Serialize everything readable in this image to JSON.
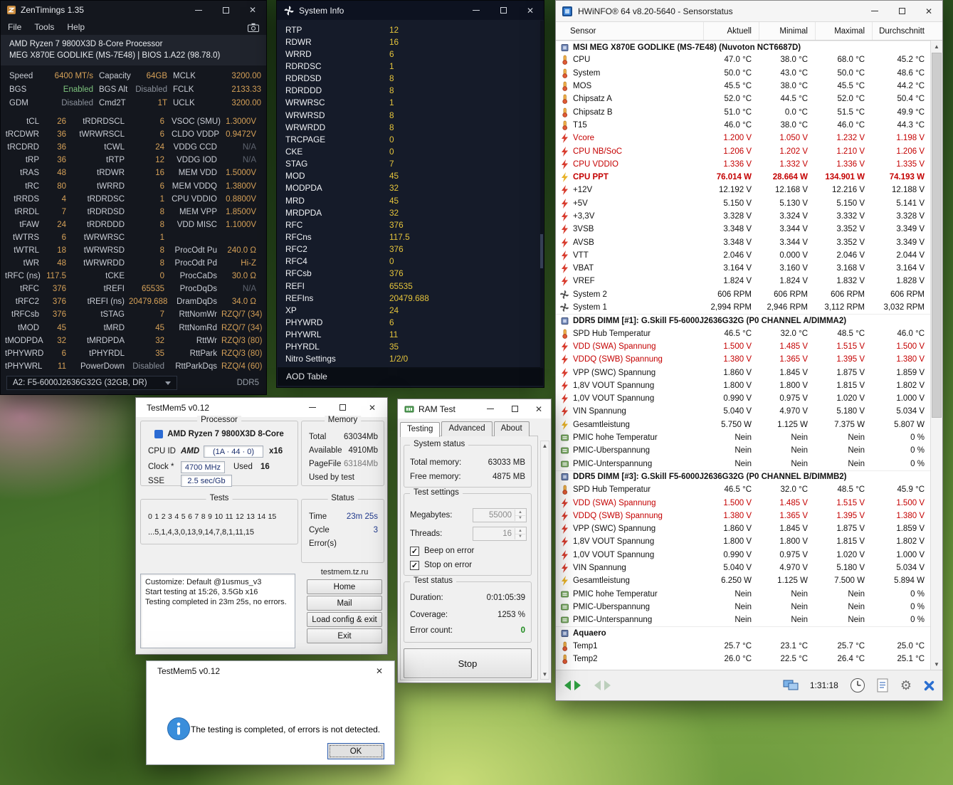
{
  "zentimings": {
    "title": "ZenTimings 1.35",
    "menu": [
      "File",
      "Tools",
      "Help"
    ],
    "cpu": "AMD Ryzen 7 9800X3D 8-Core Processor",
    "board": "MEG X870E GODLIKE (MS-7E48) | BIOS 1.A22 (98.78.0)",
    "config": [
      [
        "Speed",
        "6400 MT/s"
      ],
      [
        "Capacity",
        "64GB"
      ],
      [
        "MCLK",
        "3200.00"
      ],
      [
        "BGS",
        "Enabled"
      ],
      [
        "BGS Alt",
        "Disabled"
      ],
      [
        "FCLK",
        "2133.33"
      ],
      [
        "GDM",
        "Disabled"
      ],
      [
        "Cmd2T",
        "1T"
      ],
      [
        "UCLK",
        "3200.00"
      ]
    ],
    "timings": [
      [
        "tCL",
        "26",
        "tRDRDSCL",
        "6",
        "VSOC (SMU)",
        "1.3000V"
      ],
      [
        "tRCDWR",
        "36",
        "tWRWRSCL",
        "6",
        "CLDO VDDP",
        "0.9472V"
      ],
      [
        "tRCDRD",
        "36",
        "tCWL",
        "24",
        "VDDG CCD",
        "N/A"
      ],
      [
        "tRP",
        "36",
        "tRTP",
        "12",
        "VDDG IOD",
        "N/A"
      ],
      [
        "tRAS",
        "48",
        "tRDWR",
        "16",
        "MEM VDD",
        "1.5000V"
      ],
      [
        "tRC",
        "80",
        "tWRRD",
        "6",
        "MEM VDDQ",
        "1.3800V"
      ],
      [
        "tRRDS",
        "4",
        "tRDRDSC",
        "1",
        "CPU VDDIO",
        "0.8800V"
      ],
      [
        "tRRDL",
        "7",
        "tRDRDSD",
        "8",
        "MEM VPP",
        "1.8500V"
      ],
      [
        "tFAW",
        "24",
        "tRDRDDD",
        "8",
        "VDD MISC",
        "1.1000V"
      ],
      [
        "tWTRS",
        "6",
        "tWRWRSC",
        "1",
        "",
        ""
      ],
      [
        "tWTRL",
        "18",
        "tWRWRSD",
        "8",
        "ProcOdt Pu",
        "240.0 Ω"
      ],
      [
        "tWR",
        "48",
        "tWRWRDD",
        "8",
        "ProcOdt Pd",
        "Hi-Z"
      ],
      [
        "tRFC (ns)",
        "117.5",
        "tCKE",
        "0",
        "ProcCaDs",
        "30.0 Ω"
      ],
      [
        "tRFC",
        "376",
        "tREFI",
        "65535",
        "ProcDqDs",
        "N/A"
      ],
      [
        "tRFC2",
        "376",
        "tREFI (ns)",
        "20479.688",
        "DramDqDs",
        "34.0 Ω"
      ],
      [
        "tRFCsb",
        "376",
        "tSTAG",
        "7",
        "RttNomWr",
        "RZQ/7 (34)"
      ],
      [
        "tMOD",
        "45",
        "tMRD",
        "45",
        "RttNomRd",
        "RZQ/7 (34)"
      ],
      [
        "tMODPDA",
        "32",
        "tMRDPDA",
        "32",
        "RttWr",
        "RZQ/3 (80)"
      ],
      [
        "tPHYWRD",
        "6",
        "tPHYRDL",
        "35",
        "RttPark",
        "RZQ/3 (80)"
      ],
      [
        "tPHYWRL",
        "11",
        "PowerDown",
        "Disabled",
        "RttParkDqs",
        "RZQ/4 (60)"
      ]
    ],
    "dimm": "A2: F5-6000J2636G32G (32GB, DR)",
    "memtype": "DDR5"
  },
  "systeminfo": {
    "title": "System Info",
    "rows": [
      [
        "RTP",
        "12"
      ],
      [
        "RDWR",
        "16"
      ],
      [
        "WRRD",
        "6"
      ],
      [
        "RDRDSC",
        "1"
      ],
      [
        "RDRDSD",
        "8"
      ],
      [
        "RDRDDD",
        "8"
      ],
      [
        "WRWRSC",
        "1"
      ],
      [
        "WRWRSD",
        "8"
      ],
      [
        "WRWRDD",
        "8"
      ],
      [
        "TRCPAGE",
        "0"
      ],
      [
        "CKE",
        "0"
      ],
      [
        "STAG",
        "7"
      ],
      [
        "MOD",
        "45"
      ],
      [
        "MODPDA",
        "32"
      ],
      [
        "MRD",
        "45"
      ],
      [
        "MRDPDA",
        "32"
      ],
      [
        "RFC",
        "376"
      ],
      [
        "RFCns",
        "117.5"
      ],
      [
        "RFC2",
        "376"
      ],
      [
        "RFC4",
        "0"
      ],
      [
        "RFCsb",
        "376"
      ],
      [
        "REFI",
        "65535"
      ],
      [
        "REFIns",
        "20479.688"
      ],
      [
        "XP",
        "24"
      ],
      [
        "PHYWRD",
        "6"
      ],
      [
        "PHYWRL",
        "11"
      ],
      [
        "PHYRDL",
        "35"
      ],
      [
        "Nitro Settings",
        "1/2/0"
      ]
    ],
    "aod": "AOD Table"
  },
  "hwinfo": {
    "title": "HWiNFO® 64 v8.20-5640 - Sensorstatus",
    "columns": [
      "Sensor",
      "Aktuell",
      "Minimal",
      "Maximal",
      "Durchschnitt"
    ],
    "statusbar_time": "1:31:18",
    "groups": [
      {
        "name": "MSI MEG X870E GODLIKE (MS-7E48) (Nuvoton NCT6687D)",
        "rows": [
          {
            "i": "temp",
            "l": "CPU",
            "v": [
              "47.0 °C",
              "38.0 °C",
              "68.0 °C",
              "45.2 °C"
            ]
          },
          {
            "i": "temp",
            "l": "System",
            "v": [
              "50.0 °C",
              "43.0 °C",
              "50.0 °C",
              "48.6 °C"
            ]
          },
          {
            "i": "temp",
            "l": "MOS",
            "v": [
              "45.5 °C",
              "38.0 °C",
              "45.5 °C",
              "44.2 °C"
            ]
          },
          {
            "i": "temp",
            "l": "Chipsatz A",
            "v": [
              "52.0 °C",
              "44.5 °C",
              "52.0 °C",
              "50.4 °C"
            ]
          },
          {
            "i": "temp",
            "l": "Chipsatz B",
            "v": [
              "51.0 °C",
              "0.0 °C",
              "51.5 °C",
              "49.9 °C"
            ]
          },
          {
            "i": "temp",
            "l": "T15",
            "v": [
              "46.0 °C",
              "38.0 °C",
              "46.0 °C",
              "44.3 °C"
            ]
          },
          {
            "i": "volt",
            "l": "Vcore",
            "f": 1,
            "v": [
              "1.200 V",
              "1.050 V",
              "1.232 V",
              "1.198 V"
            ]
          },
          {
            "i": "volt",
            "l": "CPU NB/SoC",
            "f": 1,
            "v": [
              "1.206 V",
              "1.202 V",
              "1.210 V",
              "1.206 V"
            ]
          },
          {
            "i": "volt",
            "l": "CPU VDDIO",
            "f": 1,
            "v": [
              "1.336 V",
              "1.332 V",
              "1.336 V",
              "1.335 V"
            ]
          },
          {
            "i": "power",
            "l": "CPU PPT",
            "f": 1,
            "b": 1,
            "v": [
              "76.014 W",
              "28.664 W",
              "134.901 W",
              "74.193 W"
            ]
          },
          {
            "i": "volt",
            "l": "+12V",
            "v": [
              "12.192 V",
              "12.168 V",
              "12.216 V",
              "12.188 V"
            ]
          },
          {
            "i": "volt",
            "l": "+5V",
            "v": [
              "5.150 V",
              "5.130 V",
              "5.150 V",
              "5.141 V"
            ]
          },
          {
            "i": "volt",
            "l": "+3,3V",
            "v": [
              "3.328 V",
              "3.324 V",
              "3.332 V",
              "3.328 V"
            ]
          },
          {
            "i": "volt",
            "l": "3VSB",
            "v": [
              "3.348 V",
              "3.344 V",
              "3.352 V",
              "3.349 V"
            ]
          },
          {
            "i": "volt",
            "l": "AVSB",
            "v": [
              "3.348 V",
              "3.344 V",
              "3.352 V",
              "3.349 V"
            ]
          },
          {
            "i": "volt",
            "l": "VTT",
            "v": [
              "2.046 V",
              "0.000 V",
              "2.046 V",
              "2.044 V"
            ]
          },
          {
            "i": "volt",
            "l": "VBAT",
            "v": [
              "3.164 V",
              "3.160 V",
              "3.168 V",
              "3.164 V"
            ]
          },
          {
            "i": "volt",
            "l": "VREF",
            "v": [
              "1.824 V",
              "1.824 V",
              "1.832 V",
              "1.828 V"
            ]
          },
          {
            "i": "fan",
            "l": "System 2",
            "v": [
              "606 RPM",
              "606 RPM",
              "606 RPM",
              "606 RPM"
            ]
          },
          {
            "i": "fan",
            "l": "System 1",
            "v": [
              "2,994 RPM",
              "2,946 RPM",
              "3,112 RPM",
              "3,032 RPM"
            ]
          }
        ]
      },
      {
        "name": "DDR5 DIMM [#1]: G.Skill F5-6000J2636G32G (P0 CHANNEL A/DIMMA2)",
        "rows": [
          {
            "i": "temp",
            "l": "SPD Hub Temperatur",
            "v": [
              "46.5 °C",
              "32.0 °C",
              "48.5 °C",
              "46.0 °C"
            ]
          },
          {
            "i": "volt",
            "l": "VDD (SWA) Spannung",
            "f": 1,
            "v": [
              "1.500 V",
              "1.485 V",
              "1.515 V",
              "1.500 V"
            ]
          },
          {
            "i": "volt",
            "l": "VDDQ (SWB) Spannung",
            "f": 1,
            "v": [
              "1.380 V",
              "1.365 V",
              "1.395 V",
              "1.380 V"
            ]
          },
          {
            "i": "volt",
            "l": "VPP (SWC) Spannung",
            "v": [
              "1.860 V",
              "1.845 V",
              "1.875 V",
              "1.859 V"
            ]
          },
          {
            "i": "volt",
            "l": "1,8V VOUT Spannung",
            "v": [
              "1.800 V",
              "1.800 V",
              "1.815 V",
              "1.802 V"
            ]
          },
          {
            "i": "volt",
            "l": "1,0V VOUT Spannung",
            "v": [
              "0.990 V",
              "0.975 V",
              "1.020 V",
              "1.000 V"
            ]
          },
          {
            "i": "volt",
            "l": "VIN Spannung",
            "v": [
              "5.040 V",
              "4.970 V",
              "5.180 V",
              "5.034 V"
            ]
          },
          {
            "i": "power",
            "l": "Gesamtleistung",
            "v": [
              "5.750 W",
              "1.125 W",
              "7.375 W",
              "5.807 W"
            ]
          },
          {
            "i": "stat",
            "l": "PMIC hohe Temperatur",
            "v": [
              "Nein",
              "Nein",
              "Nein",
              "0 %"
            ]
          },
          {
            "i": "stat",
            "l": "PMIC-Überspannung",
            "v": [
              "Nein",
              "Nein",
              "Nein",
              "0 %"
            ]
          },
          {
            "i": "stat",
            "l": "PMIC-Unterspannung",
            "v": [
              "Nein",
              "Nein",
              "Nein",
              "0 %"
            ]
          }
        ]
      },
      {
        "name": "DDR5 DIMM [#3]: G.Skill F5-6000J2636G32G (P0 CHANNEL B/DIMMB2)",
        "rows": [
          {
            "i": "temp",
            "l": "SPD Hub Temperatur",
            "v": [
              "46.5 °C",
              "32.0 °C",
              "48.5 °C",
              "45.9 °C"
            ]
          },
          {
            "i": "volt",
            "l": "VDD (SWA) Spannung",
            "f": 1,
            "v": [
              "1.500 V",
              "1.485 V",
              "1.515 V",
              "1.500 V"
            ]
          },
          {
            "i": "volt",
            "l": "VDDQ (SWB) Spannung",
            "f": 1,
            "v": [
              "1.380 V",
              "1.365 V",
              "1.395 V",
              "1.380 V"
            ]
          },
          {
            "i": "volt",
            "l": "VPP (SWC) Spannung",
            "v": [
              "1.860 V",
              "1.845 V",
              "1.875 V",
              "1.859 V"
            ]
          },
          {
            "i": "volt",
            "l": "1,8V VOUT Spannung",
            "v": [
              "1.800 V",
              "1.800 V",
              "1.815 V",
              "1.802 V"
            ]
          },
          {
            "i": "volt",
            "l": "1,0V VOUT Spannung",
            "v": [
              "0.990 V",
              "0.975 V",
              "1.020 V",
              "1.000 V"
            ]
          },
          {
            "i": "volt",
            "l": "VIN Spannung",
            "v": [
              "5.040 V",
              "4.970 V",
              "5.180 V",
              "5.034 V"
            ]
          },
          {
            "i": "power",
            "l": "Gesamtleistung",
            "v": [
              "6.250 W",
              "1.125 W",
              "7.500 W",
              "5.894 W"
            ]
          },
          {
            "i": "stat",
            "l": "PMIC hohe Temperatur",
            "v": [
              "Nein",
              "Nein",
              "Nein",
              "0 %"
            ]
          },
          {
            "i": "stat",
            "l": "PMIC-Überspannung",
            "v": [
              "Nein",
              "Nein",
              "Nein",
              "0 %"
            ]
          },
          {
            "i": "stat",
            "l": "PMIC-Unterspannung",
            "v": [
              "Nein",
              "Nein",
              "Nein",
              "0 %"
            ]
          }
        ]
      },
      {
        "name": "Aquaero",
        "rows": [
          {
            "i": "temp",
            "l": "Temp1",
            "v": [
              "25.7 °C",
              "23.1 °C",
              "25.7 °C",
              "25.0 °C"
            ]
          },
          {
            "i": "temp",
            "l": "Temp2",
            "v": [
              "26.0 °C",
              "22.5 °C",
              "26.4 °C",
              "25.1 °C"
            ]
          }
        ]
      }
    ]
  },
  "testmem5": {
    "title": "TestMem5 v0.12",
    "processor": {
      "label": "Processor",
      "name": "AMD Ryzen 7 9800X3D 8-Core",
      "cpu_id_label": "CPU ID",
      "cpu_vendor": "AMD",
      "cpu_id": "(1A · 44 · 0)",
      "cpu_mult": "x16",
      "clock_label": "Clock *",
      "clock": "4700 MHz",
      "used_label": "Used",
      "used": "16",
      "sse_label": "SSE",
      "sse": "2.5 sec/Gb"
    },
    "memory": {
      "label": "Memory",
      "rows": [
        [
          "Total",
          "63034Mb"
        ],
        [
          "Available",
          "4910Mb"
        ],
        [
          "PageFile",
          "63184Mb"
        ],
        [
          "Used by test",
          ""
        ]
      ]
    },
    "tests": {
      "label": "Tests",
      "numbers": [
        "0",
        "1",
        "2",
        "3",
        "4",
        "5",
        "6",
        "7",
        "8",
        "9",
        "10",
        "11",
        "12",
        "13",
        "14",
        "15"
      ],
      "sequence": "...5,1,4,3,0,13,9,14,7,8,1,11,15"
    },
    "status": {
      "label": "Status",
      "rows": [
        [
          "Time",
          "23m 25s"
        ],
        [
          "Cycle",
          "3"
        ],
        [
          "Error(s)",
          ""
        ]
      ]
    },
    "log": [
      "Customize: Default @1usmus_v3",
      "Start testing at 15:26, 3.5Gb x16",
      "Testing completed in 23m 25s, no errors."
    ],
    "site": "testmem.tz.ru",
    "buttons": [
      "Home",
      "Mail",
      "Load config & exit",
      "Exit"
    ]
  },
  "ramtest": {
    "title": "RAM Test",
    "tabs": [
      "Testing",
      "Advanced",
      "About"
    ],
    "system_status": {
      "label": "System status",
      "rows": [
        [
          "Total memory:",
          "63033 MB"
        ],
        [
          "Free memory:",
          "4875 MB"
        ]
      ]
    },
    "test_settings": {
      "label": "Test settings",
      "megabytes_label": "Megabytes:",
      "megabytes": "55000",
      "threads_label": "Threads:",
      "threads": "16",
      "checkboxes": [
        "Beep on error",
        "Stop on error"
      ]
    },
    "test_status": {
      "label": "Test status",
      "rows": [
        [
          "Duration:",
          "0:01:05:39"
        ],
        [
          "Coverage:",
          "1253 %"
        ],
        [
          "Error count:",
          "0"
        ]
      ]
    },
    "stop_button": "Stop"
  },
  "dialog": {
    "title": "TestMem5 v0.12",
    "message": "The testing is completed, of errors is not detected.",
    "ok": "OK"
  }
}
